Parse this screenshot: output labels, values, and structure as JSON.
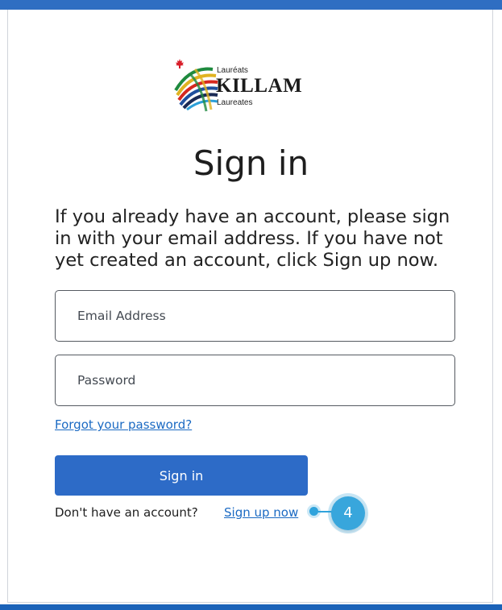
{
  "logo": {
    "top_text": "Lauréats",
    "main_text": "KILLAM",
    "bottom_text": "Laureates",
    "icon": "killam-stripes-logo",
    "maple_icon": "maple-leaf-icon"
  },
  "page": {
    "title": "Sign in",
    "intro": "If you already have an account, please sign in with your email address. If you have not yet created an account, click Sign up now."
  },
  "form": {
    "email_placeholder": "Email Address",
    "email_value": "",
    "password_placeholder": "Password",
    "password_value": "",
    "forgot_label": "Forgot your password?",
    "signin_label": "Sign in"
  },
  "signup": {
    "prompt": "Don't have an account?",
    "link_label": "Sign up now"
  },
  "callout": {
    "number": "4"
  },
  "colors": {
    "primary": "#2d6bc7",
    "link": "#1b6ac3",
    "callout": "#38a6dc",
    "maple": "#d81e2a"
  }
}
